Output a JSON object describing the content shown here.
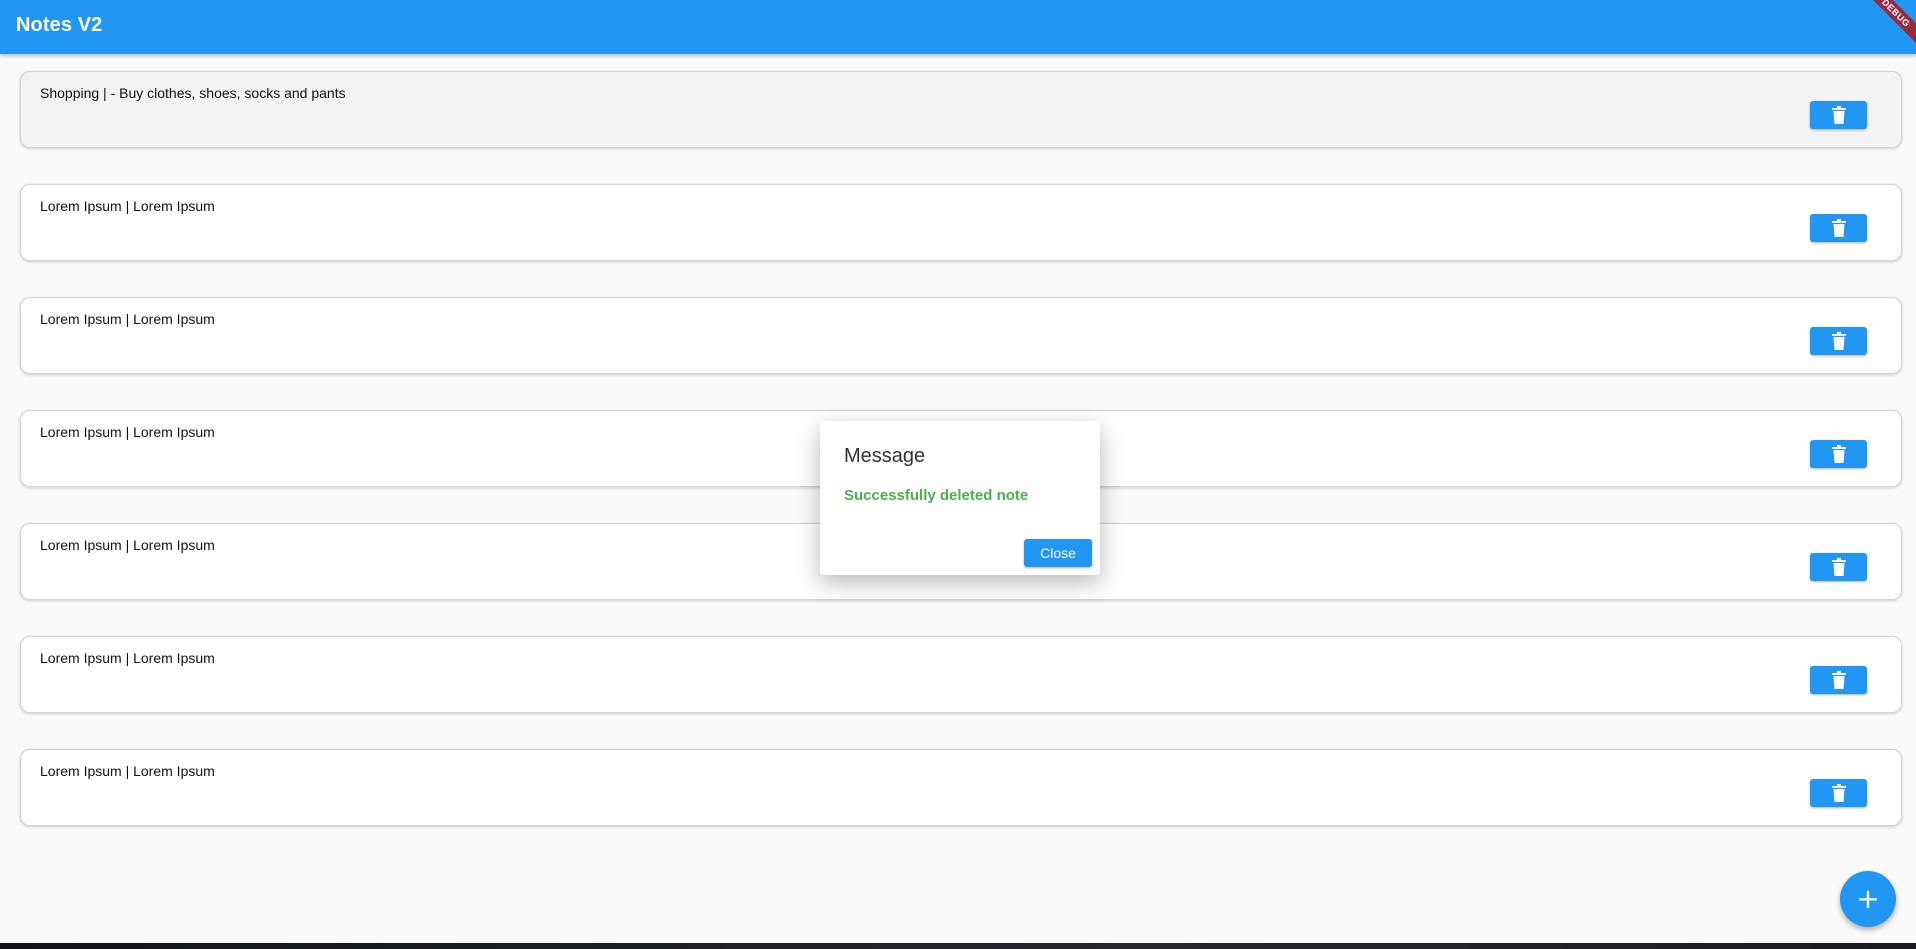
{
  "app": {
    "title": "Notes V2",
    "debug_label": "DEBUG",
    "accent_color": "#2196f3"
  },
  "notes": [
    {
      "text": "Shopping  | - Buy clothes, shoes, socks and pants",
      "action_icon": "trash-icon"
    },
    {
      "text": "Lorem Ipsum | Lorem Ipsum",
      "action_icon": "trash-icon"
    },
    {
      "text": "Lorem Ipsum | Lorem Ipsum",
      "action_icon": "trash-icon"
    },
    {
      "text": "Lorem Ipsum | Lorem Ipsum",
      "action_icon": "trash-icon"
    },
    {
      "text": "Lorem Ipsum | Lorem Ipsum",
      "action_icon": "trash-icon"
    },
    {
      "text": "Lorem Ipsum | Lorem Ipsum",
      "action_icon": "trash-icon"
    },
    {
      "text": "Lorem Ipsum | Lorem Ipsum",
      "action_icon": "trash-icon"
    }
  ],
  "dialog": {
    "title": "Message",
    "message": "Successfully deleted note",
    "message_color": "#4caf50",
    "close_label": "Close"
  },
  "fab": {
    "icon": "plus-icon",
    "symbol": "+"
  }
}
